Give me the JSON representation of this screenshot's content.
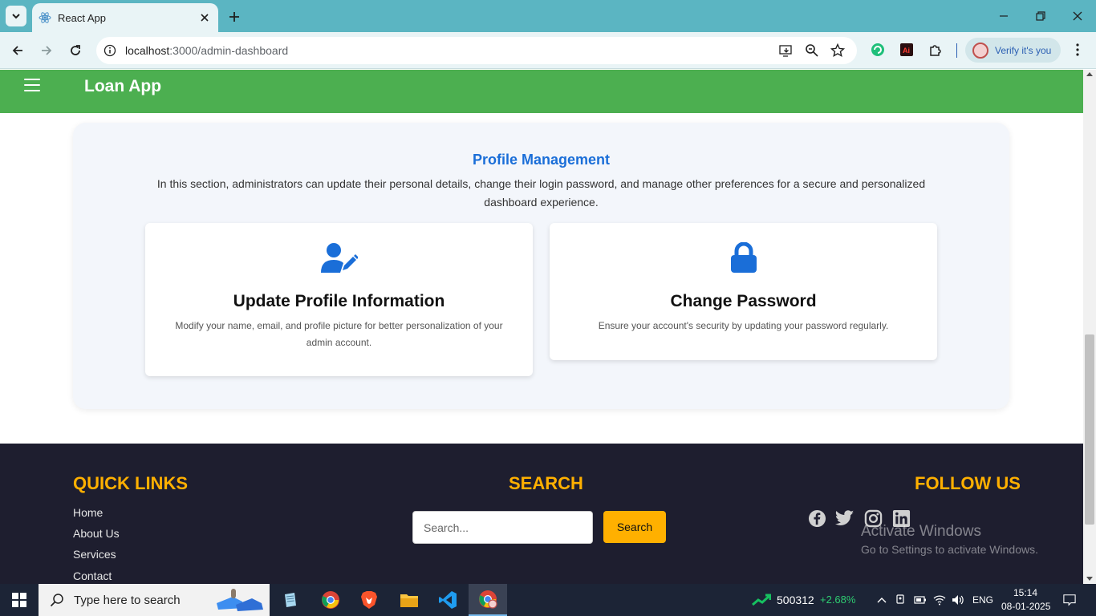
{
  "browser": {
    "tab_title": "React App",
    "url_host": "localhost",
    "url_path": ":3000/admin-dashboard",
    "verify_label": "Verify it's you"
  },
  "app": {
    "brand": "Loan App",
    "header_color": "#4caf50"
  },
  "profile_section": {
    "title": "Profile Management",
    "description": "In this section, administrators can update their personal details, change their login password, and manage other preferences for a secure and personalized dashboard experience.",
    "cards": [
      {
        "icon": "user-edit-icon",
        "title": "Update Profile Information",
        "description": "Modify your name, email, and profile picture for better personalization of your admin account."
      },
      {
        "icon": "lock-icon",
        "title": "Change Password",
        "description": "Ensure your account's security by updating your password regularly."
      }
    ]
  },
  "footer": {
    "quick_links_heading": "QUICK LINKS",
    "quick_links": [
      "Home",
      "About Us",
      "Services",
      "Contact"
    ],
    "search_heading": "SEARCH",
    "search_placeholder": "Search...",
    "search_button": "Search",
    "follow_heading": "FOLLOW US",
    "social_icons": [
      "facebook-icon",
      "twitter-icon",
      "instagram-icon",
      "linkedin-icon"
    ],
    "accent_color": "#ffb000"
  },
  "watermark": {
    "line1": "Activate Windows",
    "line2": "Go to Settings to activate Windows."
  },
  "taskbar": {
    "search_placeholder": "Type here to search",
    "stock_value": "500312",
    "stock_change": "+2.68%",
    "language": "ENG",
    "time": "15:14",
    "date": "08-01-2025"
  }
}
